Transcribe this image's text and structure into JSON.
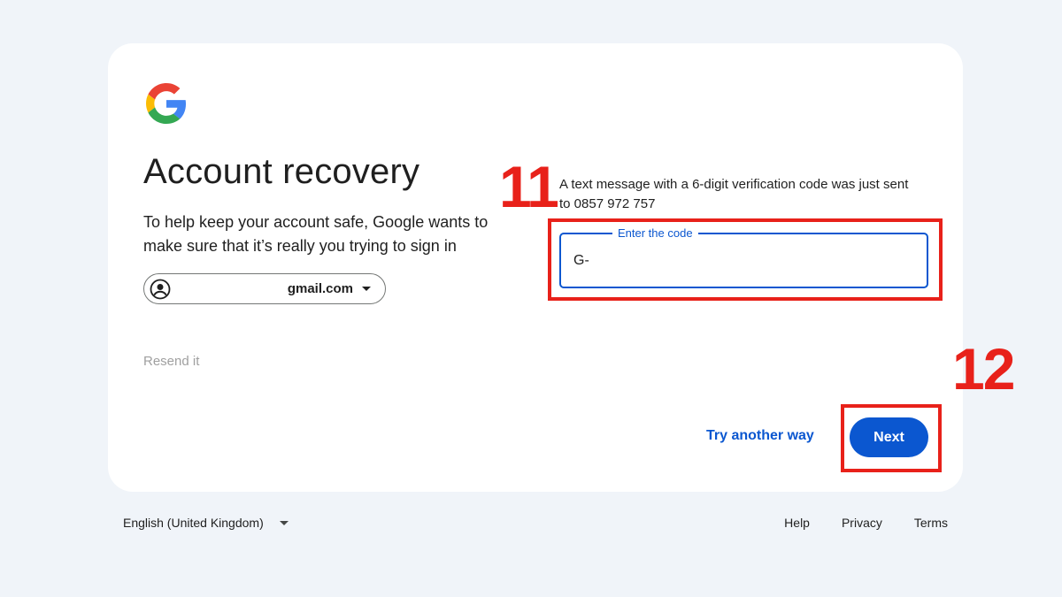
{
  "page": {
    "title": "Account recovery",
    "subtitle": "To help keep your account safe, Google wants to make sure that it’s really you trying to sign in"
  },
  "account": {
    "email": "gmail.com"
  },
  "verification": {
    "message": "A text message with a 6-digit verification code was just sent to 0857 972 757",
    "code_label": "Enter the code",
    "code_value": "G-"
  },
  "actions": {
    "resend": "Resend it",
    "try_another": "Try another way",
    "next": "Next"
  },
  "annotations": {
    "step_code": "11",
    "step_next": "12"
  },
  "footer": {
    "language": "English (United Kingdom)",
    "help": "Help",
    "privacy": "Privacy",
    "terms": "Terms"
  },
  "icons": {
    "logo": "google-logo-icon",
    "avatar": "account-circle-icon",
    "dropdown": "caret-down-icon"
  },
  "colors": {
    "background": "#f0f4f9",
    "accent": "#0b57d0",
    "annotation": "#e8211a",
    "muted": "#a0a0a0"
  }
}
